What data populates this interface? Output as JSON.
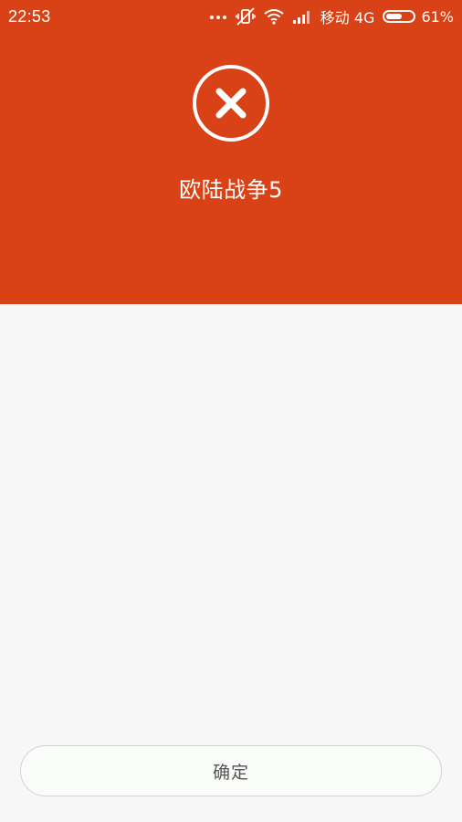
{
  "status_bar": {
    "time": "22:53",
    "carrier": "移动 4G",
    "battery_percent_label": "61%",
    "battery_level": 0.61,
    "icons": [
      "more-dots-icon",
      "vibrate-off-icon",
      "wifi-icon",
      "signal-icon",
      "battery-icon"
    ]
  },
  "header": {
    "background_color": "#d84216",
    "status_icon": "error-x-icon",
    "app_name": "欧陆战争5"
  },
  "footer": {
    "confirm_label": "确定"
  }
}
